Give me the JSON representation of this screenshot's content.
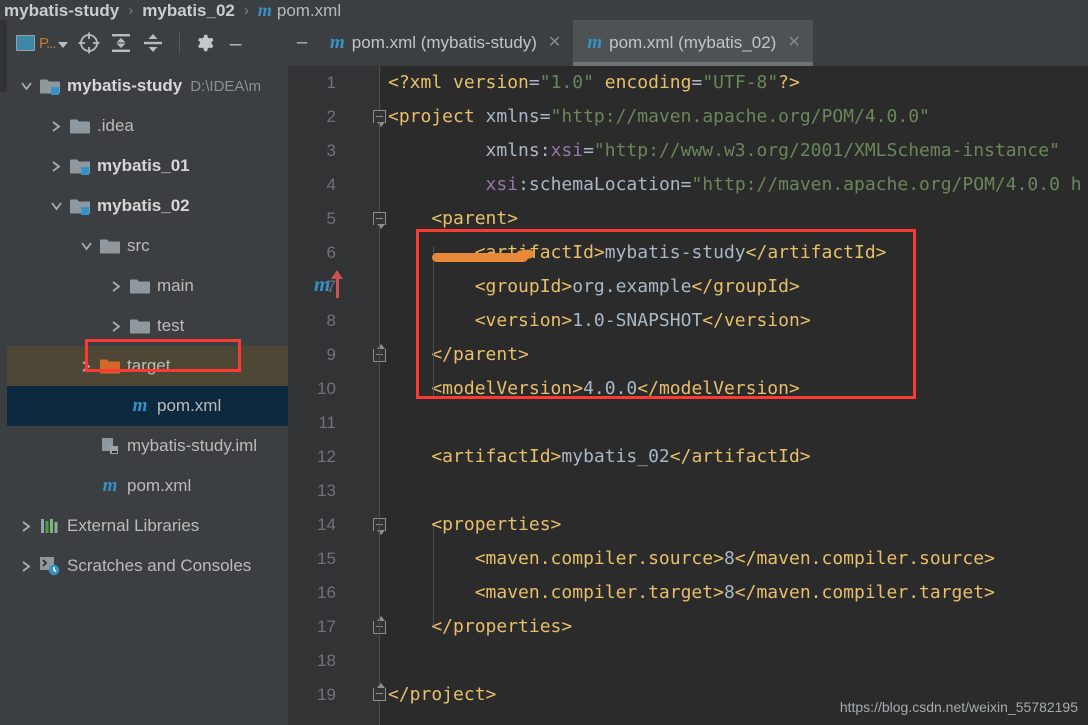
{
  "breadcrumb": {
    "items": [
      "mybatis-study",
      "mybatis_02"
    ],
    "separator": "›",
    "file": "pom.xml",
    "maven_glyph": "m"
  },
  "project_panel": {
    "toolbar": {
      "project_label": "P...",
      "icons": [
        "project-view-icon",
        "locate-target-icon",
        "expand-all-icon",
        "collapse-all-icon",
        "settings-gear-icon",
        "minimize-icon"
      ],
      "minimize_label": "–"
    },
    "tree": [
      {
        "label": "mybatis-study",
        "path": "D:\\IDEA\\m",
        "icon": "module-folder-icon",
        "twisty": "down",
        "depth": 0,
        "bold": true
      },
      {
        "label": ".idea",
        "path": "",
        "icon": "folder-icon",
        "twisty": "right",
        "depth": 1,
        "bold": false
      },
      {
        "label": "mybatis_01",
        "path": "",
        "icon": "module-folder-icon",
        "twisty": "right",
        "depth": 1,
        "bold": true
      },
      {
        "label": "mybatis_02",
        "path": "",
        "icon": "module-folder-icon",
        "twisty": "down",
        "depth": 1,
        "bold": true
      },
      {
        "label": "src",
        "path": "",
        "icon": "folder-icon",
        "twisty": "down",
        "depth": 2,
        "bold": false
      },
      {
        "label": "main",
        "path": "",
        "icon": "folder-icon",
        "twisty": "right",
        "depth": 3,
        "bold": false
      },
      {
        "label": "test",
        "path": "",
        "icon": "folder-icon",
        "twisty": "right",
        "depth": 3,
        "bold": false
      },
      {
        "label": "target",
        "path": "",
        "icon": "excluded-folder-icon",
        "twisty": "right",
        "depth": 2,
        "bold": false,
        "state": "hover"
      },
      {
        "label": "pom.xml",
        "path": "",
        "icon": "maven-file-icon",
        "twisty": "none",
        "depth": 3,
        "bold": false,
        "state": "selected"
      },
      {
        "label": "mybatis-study.iml",
        "path": "",
        "icon": "iml-file-icon",
        "twisty": "none",
        "depth": 2,
        "bold": false
      },
      {
        "label": "pom.xml",
        "path": "",
        "icon": "maven-file-icon",
        "twisty": "none",
        "depth": 2,
        "bold": false
      },
      {
        "label": "External Libraries",
        "path": "",
        "icon": "libraries-icon",
        "twisty": "right",
        "depth": 0,
        "bold": false
      },
      {
        "label": "Scratches and Consoles",
        "path": "",
        "icon": "scratches-icon",
        "twisty": "right",
        "depth": 0,
        "bold": false
      }
    ]
  },
  "editor": {
    "tabs": [
      {
        "label": "pom.xml (mybatis-study)",
        "icon": "maven-file-icon",
        "close": "✕",
        "active": false
      },
      {
        "label": "pom.xml (mybatis_02)",
        "icon": "maven-file-icon",
        "close": "✕",
        "active": true
      }
    ],
    "leading_dash": "–",
    "lines": [
      {
        "n": "1",
        "segments": [
          {
            "t": "<?xml ",
            "c": "pi"
          },
          {
            "t": "version",
            "c": "pi"
          },
          {
            "t": "=",
            "c": "tx"
          },
          {
            "t": "\"1.0\"",
            "c": "vl"
          },
          {
            "t": " encoding",
            "c": "pi"
          },
          {
            "t": "=",
            "c": "tx"
          },
          {
            "t": "\"UTF-8\"",
            "c": "vl"
          },
          {
            "t": "?>",
            "c": "pi"
          }
        ]
      },
      {
        "n": "2",
        "segments": [
          {
            "t": "<project",
            "c": "tg"
          },
          {
            "t": " xmlns",
            "c": "tx"
          },
          {
            "t": "=",
            "c": "tx"
          },
          {
            "t": "\"http://maven.apache.org/POM/4.0.0\"",
            "c": "vl"
          }
        ]
      },
      {
        "n": "3",
        "segments": [
          {
            "t": "         xmlns:",
            "c": "tx"
          },
          {
            "t": "xsi",
            "c": "at"
          },
          {
            "t": "=",
            "c": "tx"
          },
          {
            "t": "\"http://www.w3.org/2001/XMLSchema-instance\"",
            "c": "vl"
          }
        ]
      },
      {
        "n": "4",
        "segments": [
          {
            "t": "         ",
            "c": "tx"
          },
          {
            "t": "xsi",
            "c": "at"
          },
          {
            "t": ":schemaLocation",
            "c": "tx"
          },
          {
            "t": "=",
            "c": "tx"
          },
          {
            "t": "\"http://maven.apache.org/POM/4.0.0 h",
            "c": "vl"
          }
        ]
      },
      {
        "n": "5",
        "segments": [
          {
            "t": "    <parent>",
            "c": "tg"
          }
        ]
      },
      {
        "n": "6",
        "segments": [
          {
            "t": "        <artifactId>",
            "c": "tg"
          },
          {
            "t": "mybatis-study",
            "c": "tx"
          },
          {
            "t": "</artifactId>",
            "c": "tg"
          }
        ]
      },
      {
        "n": "7",
        "segments": [
          {
            "t": "        <groupId>",
            "c": "tg"
          },
          {
            "t": "org.example",
            "c": "tx"
          },
          {
            "t": "</groupId>",
            "c": "tg"
          }
        ]
      },
      {
        "n": "8",
        "segments": [
          {
            "t": "        <version>",
            "c": "tg"
          },
          {
            "t": "1.0-SNAPSHOT",
            "c": "tx"
          },
          {
            "t": "</version>",
            "c": "tg"
          }
        ]
      },
      {
        "n": "9",
        "segments": [
          {
            "t": "    </parent>",
            "c": "tg"
          }
        ]
      },
      {
        "n": "10",
        "segments": [
          {
            "t": "    <modelVersion>",
            "c": "tg"
          },
          {
            "t": "4.0.0",
            "c": "tx"
          },
          {
            "t": "</modelVersion>",
            "c": "tg"
          }
        ]
      },
      {
        "n": "11",
        "segments": []
      },
      {
        "n": "12",
        "segments": [
          {
            "t": "    <artifactId>",
            "c": "tg"
          },
          {
            "t": "mybatis_02",
            "c": "tx"
          },
          {
            "t": "</artifactId>",
            "c": "tg"
          }
        ]
      },
      {
        "n": "13",
        "segments": []
      },
      {
        "n": "14",
        "segments": [
          {
            "t": "    <properties>",
            "c": "tg"
          }
        ]
      },
      {
        "n": "15",
        "segments": [
          {
            "t": "        <maven.compiler.source>",
            "c": "tg"
          },
          {
            "t": "8",
            "c": "tx"
          },
          {
            "t": "</maven.compiler.source>",
            "c": "tg"
          }
        ]
      },
      {
        "n": "16",
        "segments": [
          {
            "t": "        <maven.compiler.target>",
            "c": "tg"
          },
          {
            "t": "8",
            "c": "tx"
          },
          {
            "t": "</maven.compiler.target>",
            "c": "tg"
          }
        ]
      },
      {
        "n": "17",
        "segments": [
          {
            "t": "    </properties>",
            "c": "tg"
          }
        ]
      },
      {
        "n": "18",
        "segments": []
      },
      {
        "n": "19",
        "segments": [
          {
            "t": "</project>",
            "c": "tg"
          }
        ]
      }
    ],
    "gutter_marker": {
      "glyph": "m",
      "icon": "maven-parent-navigate-icon"
    }
  },
  "annotations": {
    "tree_highlight_target": "pom.xml",
    "code_highlight_block": "parent",
    "underline_target": "<parent>",
    "box_color": "#fa3b33",
    "underline_color": "#e8883a"
  },
  "watermark": "https://blog.csdn.net/weixin_55782195"
}
